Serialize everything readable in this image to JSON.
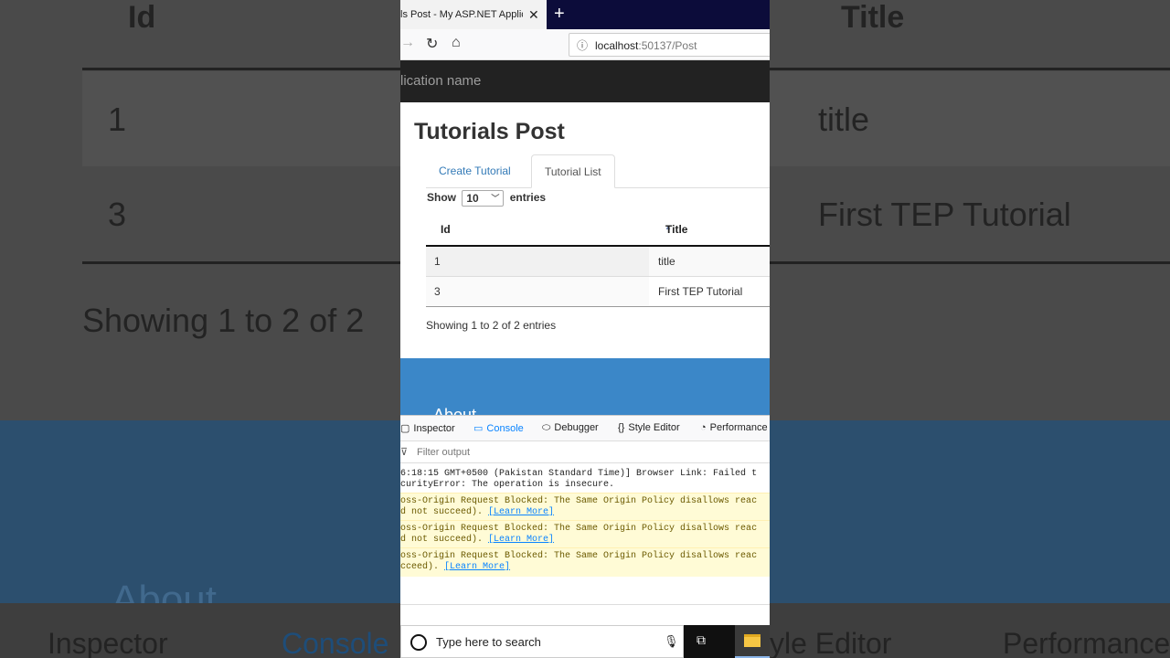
{
  "background": {
    "header_id": "Id",
    "header_title": "Title",
    "row1_id": "1",
    "row1_title": "title",
    "row2_id": "3",
    "row2_title": "First TEP Tutorial",
    "info": "Showing 1 to 2 of 2",
    "about": "About",
    "inspector": "Inspector",
    "console": "Console",
    "style_editor": "yle Editor",
    "performance": "Performance"
  },
  "browser": {
    "tab_title": "ls Post - My ASP.NET Applic",
    "url_host": "localhost",
    "url_rest": ":50137/Post"
  },
  "app": {
    "name": "lication name"
  },
  "page": {
    "title": "Tutorials Post",
    "tabs": [
      {
        "label": "Create Tutorial"
      },
      {
        "label": "Tutorial List"
      }
    ],
    "show_label": "Show",
    "page_size": "10",
    "entries_label": "entries",
    "columns": [
      "Id",
      "Title"
    ],
    "rows": [
      {
        "id": "1",
        "title": "title"
      },
      {
        "id": "3",
        "title": "First TEP Tutorial"
      }
    ],
    "info": "Showing 1 to 2 of 2 entries",
    "footer_heading": "About"
  },
  "devtools": {
    "tabs": [
      {
        "label": "Inspector"
      },
      {
        "label": "Console"
      },
      {
        "label": "Debugger"
      },
      {
        "label": "Style Editor"
      },
      {
        "label": "Performance"
      }
    ],
    "filter_placeholder": "Filter output",
    "logs": [
      {
        "line1": "6:18:15 GMT+0500 (Pakistan Standard Time)] Browser Link: Failed t",
        "line2": "curityError: The operation is insecure."
      },
      {
        "line1": "oss-Origin Request Blocked: The Same Origin Policy disallows reac",
        "line2": "d not succeed). ",
        "link": "[Learn More]"
      },
      {
        "line1": "oss-Origin Request Blocked: The Same Origin Policy disallows reac",
        "line2": "d not succeed). ",
        "link": "[Learn More]"
      },
      {
        "line1": "oss-Origin Request Blocked: The Same Origin Policy disallows reac",
        "line2": "cceed). ",
        "link": "[Learn More]"
      }
    ]
  },
  "taskbar": {
    "search_placeholder": "Type here to search"
  }
}
